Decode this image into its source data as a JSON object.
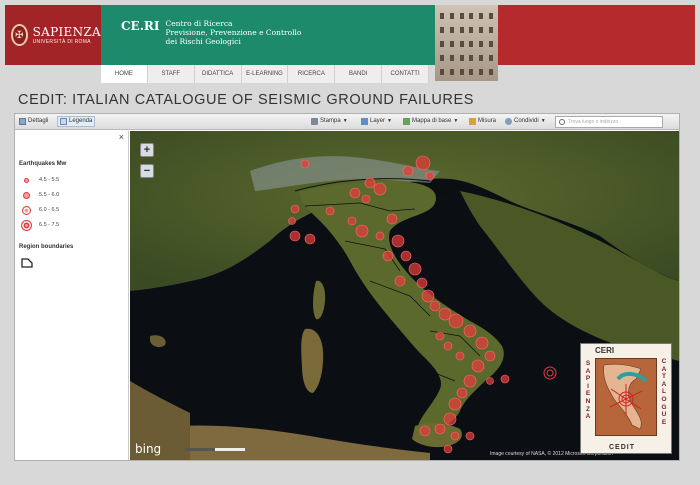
{
  "header": {
    "university_name": "SAPIENZA",
    "university_sub": "UNIVERSITÀ DI ROMA",
    "centre_abbr": "CE.RI",
    "centre_name_lines": [
      "Centro di Ricerca",
      "Previsione, Prevenzione e Controllo",
      "dei Rischi Geologici"
    ]
  },
  "nav": {
    "items": [
      "HOME",
      "STAFF",
      "DIDATTICA",
      "E-LEARNING",
      "RICERCA",
      "BANDI",
      "CONTATTI"
    ],
    "active": "HOME"
  },
  "page_title": "CEDIT: ITALIAN CATALOGUE OF SEISMIC GROUND FAILURES",
  "toolbar": {
    "details_label": "Dettagli",
    "legend_label": "Legenda",
    "print_label": "Stampa",
    "layer_label": "Layer",
    "basemap_label": "Mappa di base",
    "measure_label": "Misura",
    "share_label": "Condividi",
    "search_placeholder": "Trova luogo o indirizzo"
  },
  "legend": {
    "close_label": "×",
    "earthquakes_title": "Earthquakes Mw",
    "classes": [
      "4.5 - 5.5",
      "5.5 - 6.0",
      "6.0 - 6.5",
      "6.5 - 7.5"
    ],
    "regions_title": "Region boundaries"
  },
  "map": {
    "zoom_in": "+",
    "zoom_out": "−",
    "provider": "bing",
    "credit": "Image courtesy of NASA, © 2012 Microsoft Corporation"
  },
  "cedit_logo": {
    "top": "CERI",
    "left_vertical": "SAPIENZA",
    "right_vertical": "CATALOGUE",
    "bottom": "CEDIT"
  },
  "colors": {
    "header_red": "#b52a2c",
    "header_green": "#1d8a6c",
    "marker_red": "#e03a3a"
  }
}
